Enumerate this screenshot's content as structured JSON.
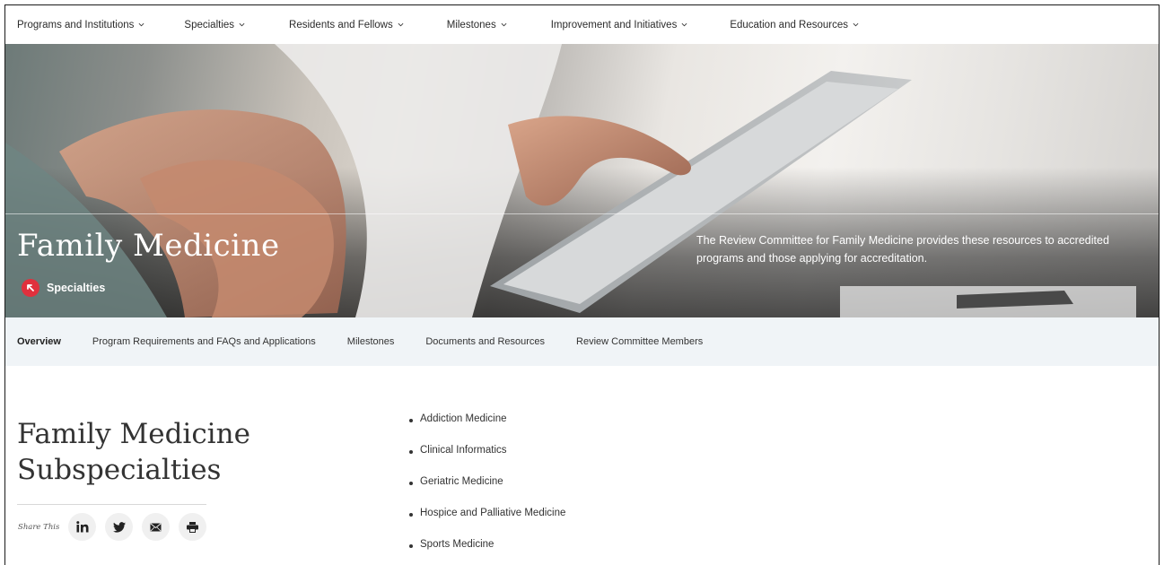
{
  "topnav": {
    "items": [
      {
        "label": "Programs and Institutions"
      },
      {
        "label": "Specialties"
      },
      {
        "label": "Residents and Fellows"
      },
      {
        "label": "Milestones"
      },
      {
        "label": "Improvement and Initiatives"
      },
      {
        "label": "Education and Resources"
      }
    ]
  },
  "hero": {
    "title": "Family Medicine",
    "breadcrumb": "Specialties",
    "description": "The Review Committee for Family Medicine provides these resources to accredited programs and those applying for accreditation."
  },
  "subnav": {
    "tabs": [
      {
        "label": "Overview",
        "active": true
      },
      {
        "label": "Program Requirements and FAQs and Applications"
      },
      {
        "label": "Milestones"
      },
      {
        "label": "Documents and Resources"
      },
      {
        "label": "Review Committee Members"
      }
    ]
  },
  "main": {
    "title_line1": "Family Medicine",
    "title_line2": "Subspecialties",
    "share_label": "Share This",
    "share_icons": [
      "linkedin-icon",
      "twitter-icon",
      "email-icon",
      "print-icon"
    ],
    "subspecialties": [
      "Addiction Medicine",
      "Clinical Informatics",
      "Geriatric Medicine",
      "Hospice and Palliative Medicine",
      "Sports Medicine"
    ]
  },
  "colors": {
    "accent_red": "#e0303d",
    "subnav_bg": "#f0f4f7",
    "text": "#333333"
  }
}
